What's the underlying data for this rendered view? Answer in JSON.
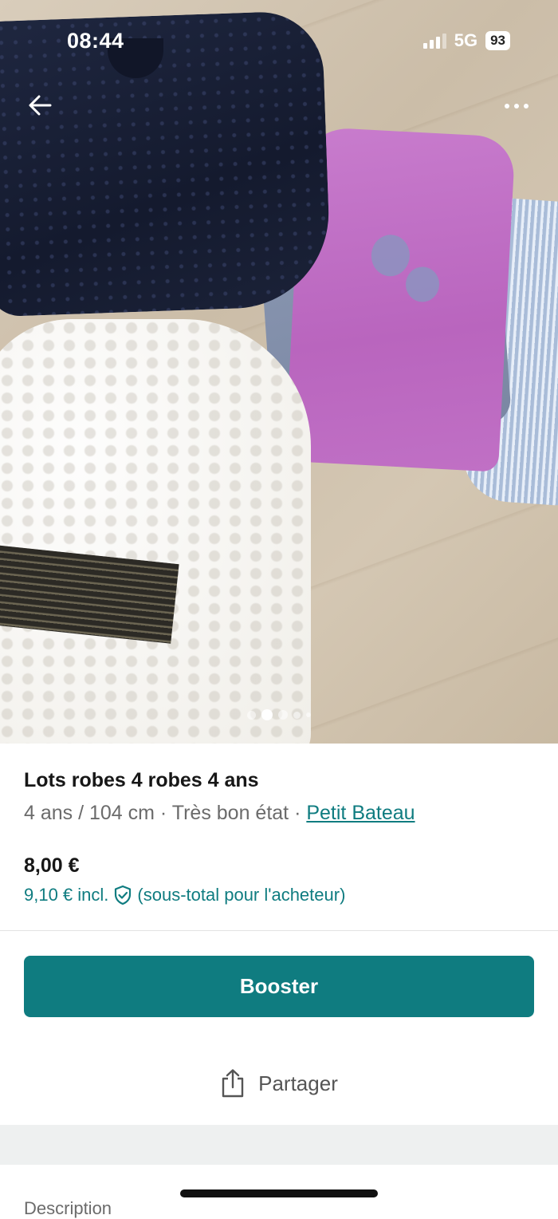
{
  "status_bar": {
    "time": "08:44",
    "network": "5G",
    "battery": "93"
  },
  "photo": {
    "carousel_count": 5,
    "active_index": 1
  },
  "item": {
    "title": "Lots robes 4 robes  4 ans",
    "size": "4 ans / 104 cm",
    "separator": " · ",
    "condition": "Très bon état",
    "brand": "Petit Bateau",
    "price": "8,00 €",
    "price_incl_prefix": "9,10 € incl.",
    "price_incl_suffix": "(sous-total pour l'acheteur)"
  },
  "actions": {
    "booster_label": "Booster",
    "share_label": "Partager"
  },
  "sections": {
    "description_label": "Description"
  },
  "colors": {
    "accent": "#0f7c80"
  }
}
